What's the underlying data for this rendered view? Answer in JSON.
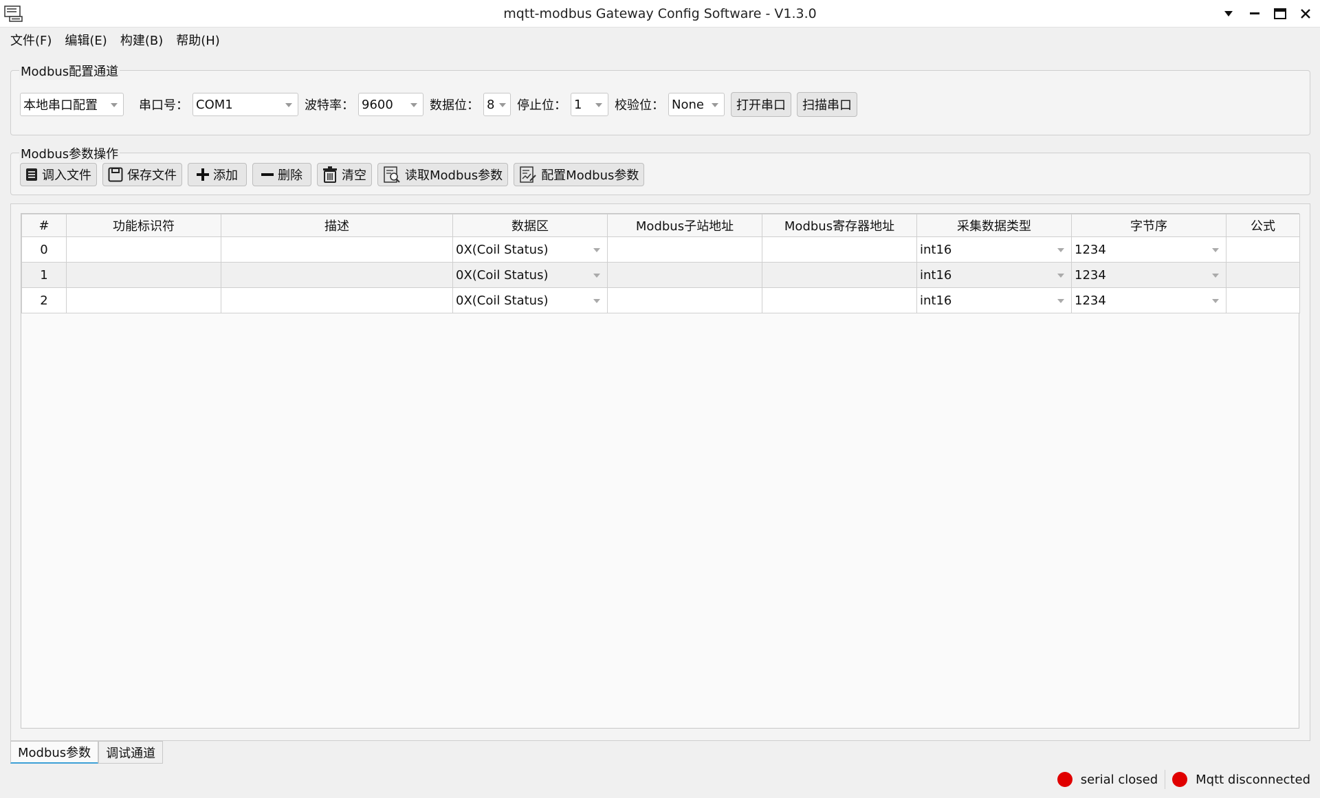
{
  "window": {
    "title": "mqtt-modbus Gateway Config Software - V1.3.0"
  },
  "menu": [
    {
      "label": "文件(F)"
    },
    {
      "label": "编辑(E)"
    },
    {
      "label": "构建(B)"
    },
    {
      "label": "帮助(H)"
    }
  ],
  "channel_group": {
    "title": "Modbus配置通道",
    "mode_select": "本地串口配置",
    "port_label": "串口号：",
    "port_value": "COM1",
    "baud_label": "波特率：",
    "baud_value": "9600",
    "databits_label": "数据位：",
    "databits_value": "8",
    "stopbits_label": "停止位：",
    "stopbits_value": "1",
    "parity_label": "校验位：",
    "parity_value": "None",
    "open_button": "打开串口",
    "scan_button": "扫描串口"
  },
  "ops_group": {
    "title": "Modbus参数操作",
    "import_button": "调入文件",
    "save_button": "保存文件",
    "add_button": "添加",
    "delete_button": "删除",
    "clear_button": "清空",
    "read_button": "读取Modbus参数",
    "config_button": "配置Modbus参数"
  },
  "table": {
    "headers": [
      "#",
      "功能标识符",
      "描述",
      "数据区",
      "Modbus子站地址",
      "Modbus寄存器地址",
      "采集数据类型",
      "字节序",
      "公式"
    ],
    "rows": [
      {
        "index": "0",
        "func_id": "",
        "desc": "",
        "area": "0X(Coil Status)",
        "slave": "",
        "reg": "",
        "dtype": "int16",
        "order": "1234",
        "formula": ""
      },
      {
        "index": "1",
        "func_id": "",
        "desc": "",
        "area": "0X(Coil Status)",
        "slave": "",
        "reg": "",
        "dtype": "int16",
        "order": "1234",
        "formula": ""
      },
      {
        "index": "2",
        "func_id": "",
        "desc": "",
        "area": "0X(Coil Status)",
        "slave": "",
        "reg": "",
        "dtype": "int16",
        "order": "1234",
        "formula": ""
      }
    ]
  },
  "tabs": [
    {
      "label": "Modbus参数"
    },
    {
      "label": "调试通道"
    }
  ],
  "status": {
    "serial": "serial closed",
    "mqtt": "Mqtt disconnected",
    "indicator_color": "#e00000"
  }
}
